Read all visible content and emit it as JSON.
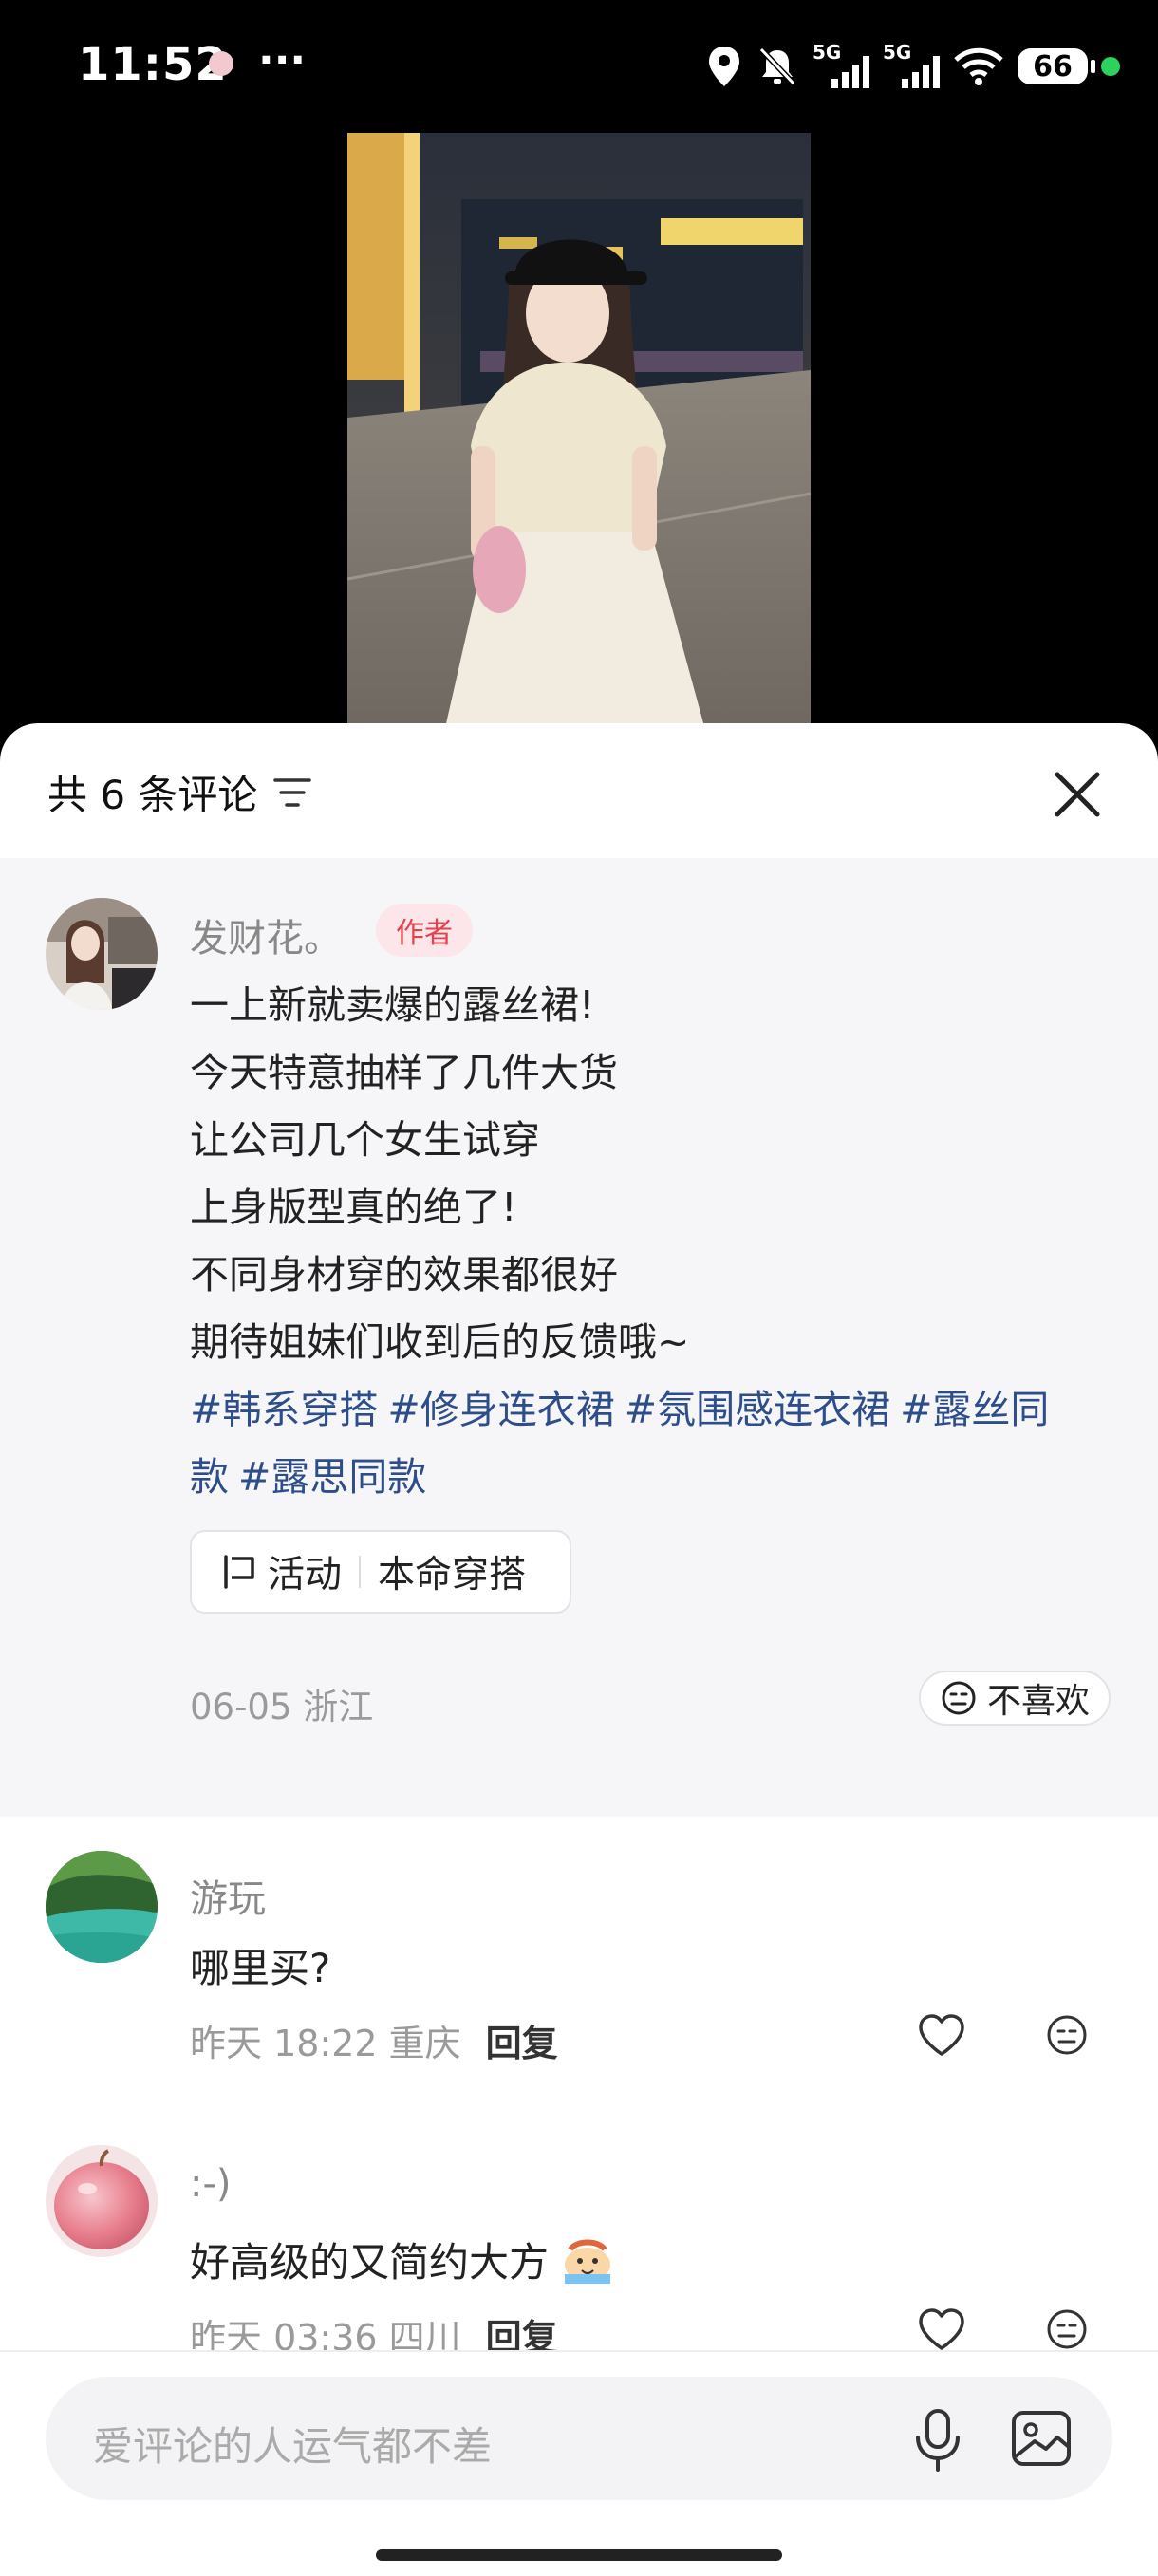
{
  "status_bar": {
    "time": "11:52",
    "dots": "···",
    "network_1": "5G",
    "network_2": "5G",
    "battery": "66"
  },
  "comments_sheet": {
    "title": "共 6 条评论",
    "author_post": {
      "name": "发财花。",
      "tag": "作者",
      "lines": [
        "一上新就卖爆的露丝裙!",
        "今天特意抽样了几件大货",
        "让公司几个女生试穿",
        "上身版型真的绝了!",
        "不同身材穿的效果都很好",
        "期待姐妹们收到后的反馈哦~"
      ],
      "hashtags_line1": [
        "#韩系穿搭",
        "#修身连衣裙",
        "#氛围感连衣裙",
        "#露丝同"
      ],
      "hashtags_line2": [
        "款",
        "#露思同款"
      ],
      "activity_label": "活动",
      "activity_name": "本命穿搭",
      "meta": "06-05 浙江",
      "dislike": "不喜欢"
    },
    "comments": [
      {
        "name": "游玩",
        "text": "哪里买?",
        "meta": "昨天 18:22 重庆",
        "reply": "回复"
      },
      {
        "name": ":-)",
        "text": "好高级的又简约大方",
        "meta": "昨天 03:36 四川",
        "reply": "回复"
      }
    ]
  },
  "input": {
    "placeholder": "爱评论的人运气都不差"
  }
}
